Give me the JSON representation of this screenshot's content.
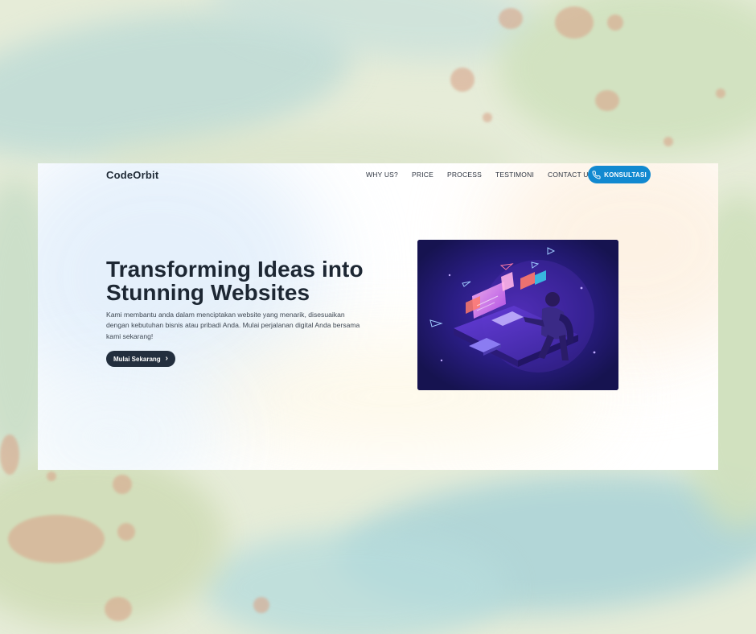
{
  "brand": {
    "logo": "CodeOrbit"
  },
  "nav": {
    "items": [
      {
        "label": "WHY US?"
      },
      {
        "label": "PRICE"
      },
      {
        "label": "PROCESS"
      },
      {
        "label": "TESTIMONI"
      },
      {
        "label": "CONTACT US"
      }
    ],
    "cta_label": "KONSULTASI",
    "cta_icon": "phone-icon",
    "cta_color": "#1189d0"
  },
  "hero": {
    "title_line1": "Transforming Ideas into",
    "title_line2": "Stunning Websites",
    "description": "Kami membantu anda dalam menciptakan website yang menarik, disesuaikan dengan kebutuhan bisnis atau pribadi Anda. Mulai perjalanan digital Anda bersama kami sekarang!",
    "button_label": "Mulai Sekarang",
    "button_icon": "chevron-right-icon",
    "button_color": "#232f3e",
    "illustration": "developer-workstation-illustration"
  }
}
